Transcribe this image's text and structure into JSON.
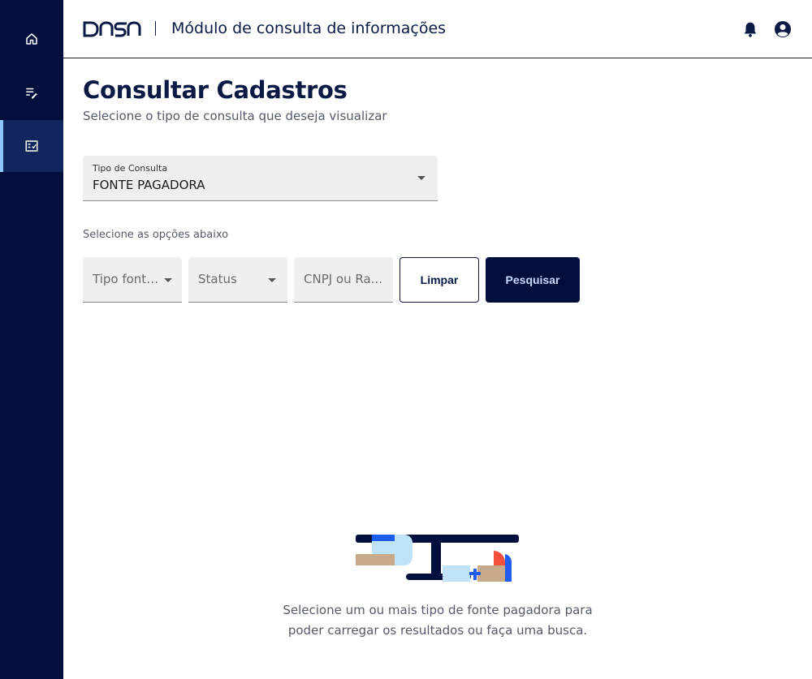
{
  "sidebar": {
    "items": [
      {
        "icon": "home-icon"
      },
      {
        "icon": "edit-list-icon"
      },
      {
        "icon": "checklist-icon",
        "active": true
      }
    ]
  },
  "header": {
    "logo_text": "DASA",
    "module_title": "Módulo de consulta de informações"
  },
  "page": {
    "title": "Consultar Cadastros",
    "subtitle": "Selecione o tipo de consulta que deseja visualizar"
  },
  "query_type": {
    "label": "Tipo de Consulta",
    "value": "FONTE PAGADORA"
  },
  "filters": {
    "label": "Selecione as opções abaixo",
    "source_type_placeholder": "Tipo fonte p...",
    "status_placeholder": "Status",
    "cnpj_placeholder": "CNPJ ou Ra..."
  },
  "buttons": {
    "clear": "Limpar",
    "search": "Pesquisar"
  },
  "empty_state": {
    "message": "Selecione um ou mais tipo de fonte pagadora para poder carregar os resultados ou faça uma busca."
  },
  "colors": {
    "sidebar_bg": "#020f3c",
    "accent": "#8ec8ff",
    "primary": "#0b1a45"
  }
}
